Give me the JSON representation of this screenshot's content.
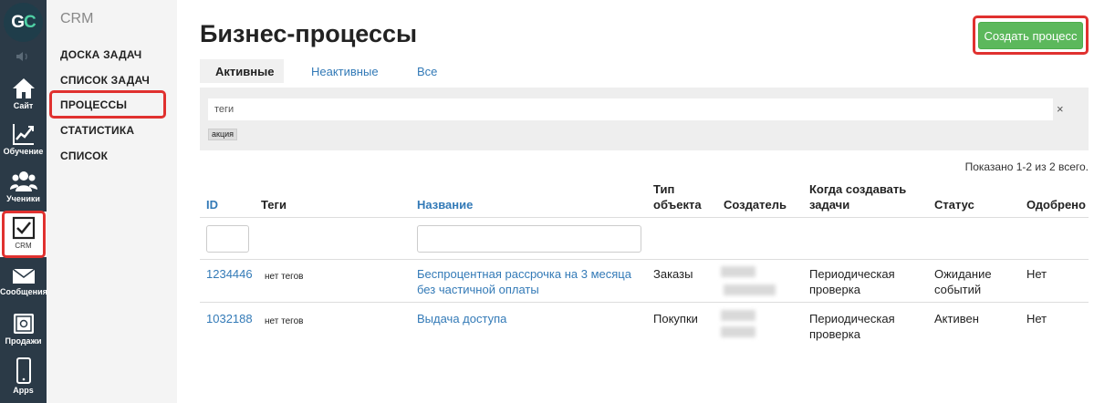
{
  "rail": {
    "logo": {
      "left": "G",
      "right": "C"
    },
    "items": [
      {
        "label": "Сайт",
        "icon": "home-icon"
      },
      {
        "label": "Обучение",
        "icon": "chart-icon"
      },
      {
        "label": "Ученики",
        "icon": "users-icon"
      },
      {
        "label": "CRM",
        "icon": "checkbox-icon"
      },
      {
        "label": "Сообщения",
        "icon": "envelope-icon"
      },
      {
        "label": "Продажи",
        "icon": "safe-icon"
      },
      {
        "label": "Apps",
        "icon": "phone-icon"
      }
    ]
  },
  "submenu": {
    "title": "CRM",
    "items": [
      {
        "label": "ДОСКА ЗАДАЧ"
      },
      {
        "label": "СПИСОК ЗАДАЧ"
      },
      {
        "label": "ПРОЦЕССЫ"
      },
      {
        "label": "СТАТИСТИКА"
      },
      {
        "label": "СПИСОК"
      }
    ]
  },
  "page": {
    "title": "Бизнес-процессы",
    "create_button": "Создать процесс"
  },
  "tabs": [
    {
      "label": "Активные"
    },
    {
      "label": "Неактивные"
    },
    {
      "label": "Все"
    }
  ],
  "filter": {
    "input_value": "теги",
    "clear": "×",
    "tag": "акция"
  },
  "summary": "Показано 1-2 из 2 всего.",
  "table": {
    "headers": {
      "id": "ID",
      "tags": "Теги",
      "name": "Название",
      "object_type": "Тип объекта",
      "creator": "Создатель",
      "when_create": "Когда создавать задачи",
      "status": "Статус",
      "approved": "Одобрено"
    },
    "rows": [
      {
        "id": "1234446",
        "tags": "нет тегов",
        "name": "Беспроцентная рассрочка на 3 месяца без частичной оплаты",
        "object_type": "Заказы",
        "when_create": "Периодическая проверка",
        "status": "Ожидание событий",
        "approved": "Нет"
      },
      {
        "id": "1032188",
        "tags": "нет тегов",
        "name": "Выдача доступа",
        "object_type": "Покупки",
        "when_create": "Периодическая проверка",
        "status": "Активен",
        "approved": "Нет"
      }
    ]
  },
  "colors": {
    "rail_bg": "#2b3a47",
    "accent_green": "#5cb85c",
    "link_blue": "#337ab7",
    "highlight_red": "#e0312f"
  }
}
